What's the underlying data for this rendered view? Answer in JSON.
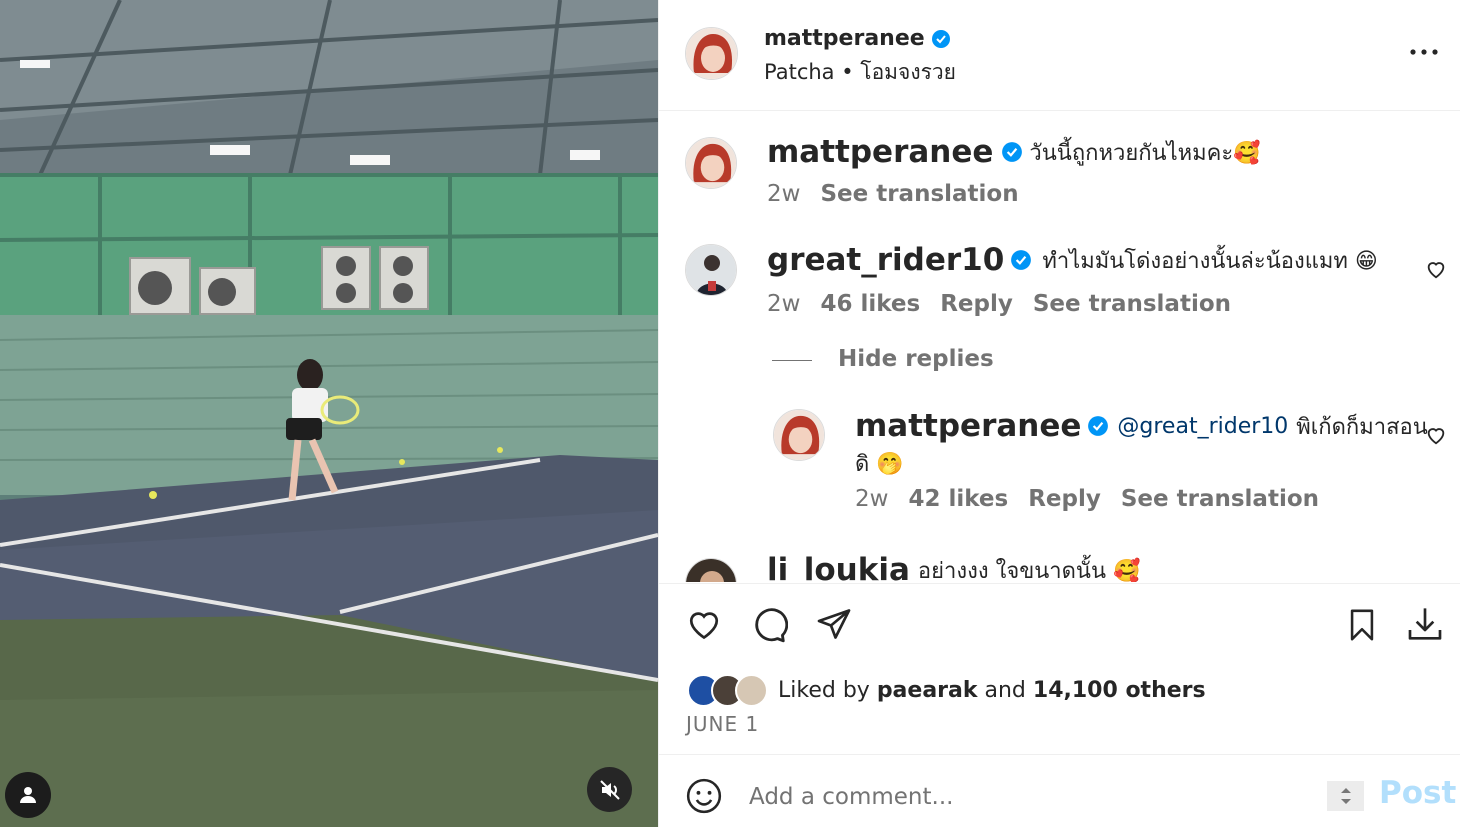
{
  "post": {
    "author": "mattperanee",
    "subtitle": "Patcha • โอมจงรวย"
  },
  "comments": [
    {
      "username": "mattperanee",
      "text": "วันนี้ถูกหวยกันไหมคะ🥰",
      "time": "2w",
      "see_translation": "See translation"
    },
    {
      "username": "great_rider10",
      "text": "ทำไมมันโด่งอย่างนั้นล่ะน้องแมท 😁",
      "time": "2w",
      "likes": "46 likes",
      "reply": "Reply",
      "see_translation": "See translation",
      "hide_replies": "Hide replies",
      "replies": [
        {
          "username": "mattperanee",
          "mention": "@great_rider10",
          "text_line1": "พิเก้ดก็มาสอน",
          "text_line2": "ดิ 🤭",
          "time": "2w",
          "likes": "42 likes",
          "reply": "Reply",
          "see_translation": "See translation"
        }
      ]
    },
    {
      "username": "li_loukia",
      "text": "อย่างงง ใจขนาดนั้น 🥰"
    }
  ],
  "liked_by": {
    "prefix": "Liked by",
    "user": "paearak",
    "and": "and",
    "others": "14,100 others"
  },
  "date": "JUNE 1",
  "composer": {
    "placeholder": "Add a comment...",
    "post_label": "Post"
  },
  "colors": {
    "verified": "#0095f6",
    "post_disabled": "#b2dffc",
    "secondary_text": "#737373"
  }
}
